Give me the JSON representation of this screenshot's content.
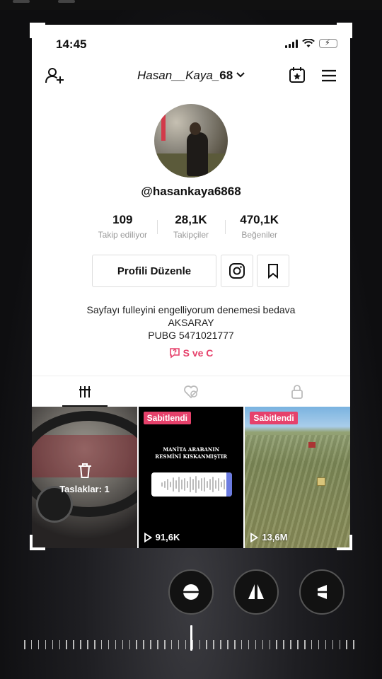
{
  "status": {
    "time": "14:45"
  },
  "header": {
    "username_prefix": "Hasan__Kaya_",
    "username_suffix": "68"
  },
  "profile": {
    "handle": "@hasankaya6868",
    "stats": [
      {
        "value": "109",
        "label": "Takip ediliyor"
      },
      {
        "value": "28,1K",
        "label": "Takipçiler"
      },
      {
        "value": "470,1K",
        "label": "Beğeniler"
      }
    ],
    "edit_button": "Profili Düzenle",
    "bio_lines": [
      "Sayfayı fulleyini engelliyorum denemesi bedava",
      "AKSARAY",
      "PUBG 5471021777"
    ],
    "bio_link": "S ve C"
  },
  "grid": {
    "draft_label": "Taslaklar: 1",
    "videos": [
      {
        "pinned_label": "Sabitlendi",
        "caption_line1": "MANİTA ARABANIN",
        "caption_line2": "RESMİNİ KISKANMIŞTIR",
        "views": "91,6K"
      },
      {
        "pinned_label": "Sabitlendi",
        "views": "13,6M"
      }
    ]
  },
  "colors": {
    "accent_pink": "#e6416b",
    "text_dark": "#111111",
    "text_muted": "#999999",
    "battery_green": "#4cd964"
  },
  "icons": {
    "header_left": "add-user-icon",
    "header_right_1": "calendar-star-icon",
    "header_right_2": "hamburger-menu-icon",
    "tabs": [
      "grid-icon",
      "liked-heart-icon",
      "lock-icon"
    ],
    "tools": [
      "straighten-icon",
      "flip-horizontal-icon",
      "perspective-icon"
    ]
  }
}
